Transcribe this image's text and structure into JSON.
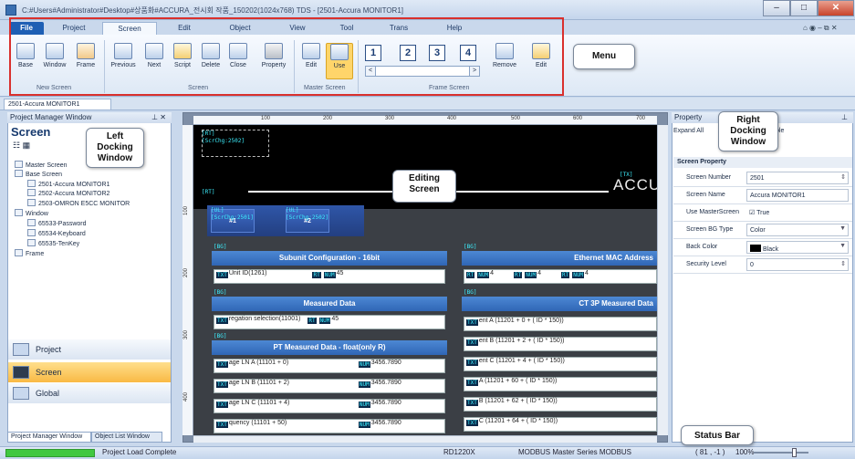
{
  "window": {
    "title": "C:#Users#Administrator#Desktop#상품화#ACCURA_전시회 작품_150202(1024x768) TDS - [2501-Accura MONITOR1]"
  },
  "tabs": [
    "File",
    "Project",
    "Screen",
    "Edit",
    "Object",
    "View",
    "Tool",
    "Trans",
    "Help"
  ],
  "ribbon": {
    "new_screen": {
      "buttons": [
        "Base",
        "Window",
        "Frame"
      ],
      "group": "New Screen"
    },
    "screen": {
      "buttons": [
        "Previous",
        "Next",
        "Script",
        "Delete",
        "Close",
        "Property"
      ],
      "group": "Screen"
    },
    "master": {
      "buttons": [
        "Edit",
        "Use"
      ],
      "group": "Master Screen"
    },
    "frame": {
      "numbers": [
        "1",
        "2",
        "3",
        "4"
      ],
      "buttons": [
        "Remove",
        "Edit"
      ],
      "group": "Frame Screen",
      "prev": "<",
      "next": ">"
    }
  },
  "callouts": {
    "menu": "Menu",
    "left": "Left\nDocking\nWindow",
    "editing": "Editing\nScreen",
    "right": "Right\nDocking\nWindow",
    "status": "Status Bar"
  },
  "doc_tab": "2501-Accura MONITOR1",
  "left_panel": {
    "title": "Project Manager Window",
    "heading": "Screen",
    "tree": [
      {
        "label": "Master Screen",
        "indent": 0
      },
      {
        "label": "Base Screen",
        "indent": 0
      },
      {
        "label": "2501-Accura MONITOR1",
        "indent": 2
      },
      {
        "label": "2502-Accura MONITOR2",
        "indent": 2
      },
      {
        "label": "2503-OMRON E5CC MONITOR",
        "indent": 2
      },
      {
        "label": "Window",
        "indent": 0
      },
      {
        "label": "65533-Password",
        "indent": 2
      },
      {
        "label": "65534-Keyboard",
        "indent": 2
      },
      {
        "label": "65535-TenKey",
        "indent": 2
      },
      {
        "label": "Frame",
        "indent": 0
      }
    ],
    "nav": [
      "Project",
      "Screen",
      "Global"
    ],
    "bottom_tabs": [
      "Project Manager Window",
      "Object List Window"
    ]
  },
  "ruler": {
    "top": [
      "100",
      "200",
      "300",
      "400",
      "500",
      "600",
      "700"
    ],
    "left": [
      "100",
      "200",
      "300",
      "400"
    ]
  },
  "canvas": {
    "tags": {
      "rt": "[RT]",
      "scr": "[ScrChg:2502]",
      "rt2": "[RT]",
      "tx": "[TX]",
      "ul1": "[UL]",
      "ul1b": "[ScrChg:2501]",
      "ul2": "[UL]",
      "ul2b": "[ScrChg:2502]",
      "bg": "[BG]"
    },
    "accu": "ACCU",
    "buttons": [
      "#1",
      "#2"
    ],
    "panels": {
      "subunit": "Subunit Configuration - 16bit",
      "subunit_row": "Unit ID(1261)",
      "subunit_val": "45",
      "measured": "Measured Data",
      "measured_row": "regation selection(11001)",
      "measured_val": "45",
      "pt": "PT Measured Data - float(only R)",
      "pt_rows": [
        "age LN A (11101 + 0)",
        "age LN B (11101 + 2)",
        "age LN C (11101 + 4)",
        "quency (11101 + 50)"
      ],
      "pt_val": "3456.7890",
      "eth": "Ethernet MAC Address",
      "eth_val": "4",
      "ct": "CT 3P Measured Data",
      "ct_rows": [
        "ent A (11201 + 0 + ( ID * 150))",
        "ent B (11201 + 2 + ( ID * 150))",
        "ent C (11201 + 4 + ( ID * 150))",
        "A (11201 + 60 + ( ID * 150))",
        "B (11201 + 62 + ( ID * 150))",
        "C (11201 + 64 + ( ID * 150))"
      ]
    }
  },
  "right_panel": {
    "title": "Property",
    "expand": "Expand All",
    "extra": "ble",
    "section": "Screen Property",
    "props": [
      {
        "key": "Screen Number",
        "value": "2501"
      },
      {
        "key": "Screen Name",
        "value": "Accura MONITOR1"
      },
      {
        "key": "Use MasterScreen",
        "value": "True"
      },
      {
        "key": "Screen BG Type",
        "value": "Color"
      },
      {
        "key": "Back Color",
        "value": "Black"
      },
      {
        "key": "Security Level",
        "value": "0"
      }
    ]
  },
  "status": {
    "load": "Project Load Complete",
    "device": "RD1220X",
    "protocol": "MODBUS Master Series MODBUS",
    "coords": "( 81 , -1 )",
    "zoom": "100%"
  }
}
